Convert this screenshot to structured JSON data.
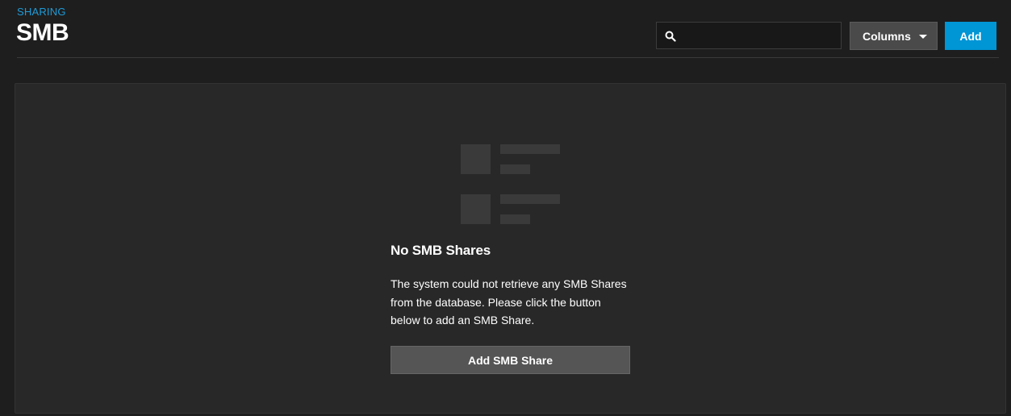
{
  "header": {
    "breadcrumb": "SHARING",
    "title": "SMB"
  },
  "toolbar": {
    "search": {
      "value": "",
      "placeholder": "",
      "icon": "search-icon"
    },
    "columns_label": "Columns",
    "add_label": "Add"
  },
  "empty_state": {
    "title": "No SMB Shares",
    "message": "The system could not retrieve any SMB Shares from the database. Please click the button below to add an SMB Share.",
    "button_label": "Add SMB Share"
  },
  "colors": {
    "accent": "#0095d5",
    "breadcrumb": "#1e9bd7",
    "background": "#1e1e1e",
    "card": "#282828"
  }
}
